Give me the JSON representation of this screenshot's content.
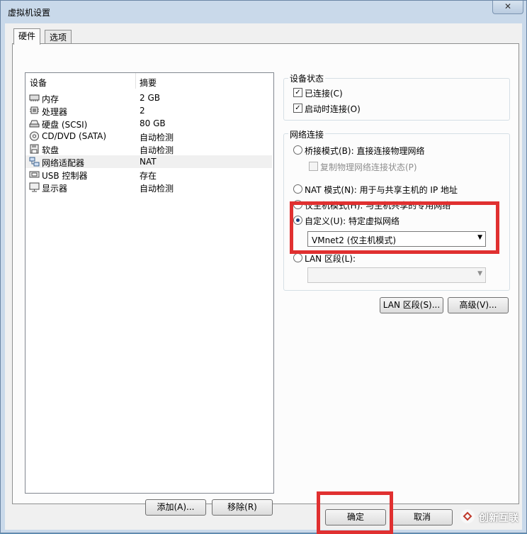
{
  "window": {
    "title": "虚拟机设置",
    "close_glyph": "✕"
  },
  "tabs": [
    {
      "label": "硬件",
      "active": true
    },
    {
      "label": "选项",
      "active": false
    }
  ],
  "device_list": {
    "columns": {
      "device": "设备",
      "summary": "摘要"
    },
    "rows": [
      {
        "icon": "memory-icon",
        "device": "内存",
        "summary": "2 GB"
      },
      {
        "icon": "cpu-icon",
        "device": "处理器",
        "summary": "2"
      },
      {
        "icon": "hard-disk-icon",
        "device": "硬盘 (SCSI)",
        "summary": "80 GB"
      },
      {
        "icon": "cd-dvd-icon",
        "device": "CD/DVD (SATA)",
        "summary": "自动检测"
      },
      {
        "icon": "floppy-icon",
        "device": "软盘",
        "summary": "自动检测"
      },
      {
        "icon": "network-adapter-icon",
        "device": "网络适配器",
        "summary": "NAT",
        "selected": true
      },
      {
        "icon": "usb-icon",
        "device": "USB 控制器",
        "summary": "存在"
      },
      {
        "icon": "display-icon",
        "device": "显示器",
        "summary": "自动检测"
      }
    ]
  },
  "list_buttons": {
    "add": "添加(A)...",
    "remove": "移除(R)"
  },
  "device_status": {
    "title": "设备状态",
    "connected": {
      "label": "已连接(C)",
      "checked": true
    },
    "connect_on_power": {
      "label": "启动时连接(O)",
      "checked": true
    }
  },
  "network": {
    "title": "网络连接",
    "bridged": {
      "label": "桥接模式(B): 直接连接物理网络",
      "selected": false
    },
    "replicate": {
      "label": "复制物理网络连接状态(P)",
      "checked": false
    },
    "nat": {
      "label": "NAT 模式(N): 用于与共享主机的 IP 地址",
      "selected": false
    },
    "host_only": {
      "label": "仅主机模式(H): 与主机共享的专用网络",
      "selected": false
    },
    "custom": {
      "label": "自定义(U): 特定虚拟网络",
      "selected": true
    },
    "custom_value": "VMnet2 (仅主机模式)",
    "lan": {
      "label": "LAN 区段(L):",
      "selected": false
    },
    "lan_value": ""
  },
  "network_buttons": {
    "lan_segments": "LAN 区段(S)...",
    "advanced": "高级(V)..."
  },
  "dialog_buttons": {
    "ok": "确定",
    "cancel": "取消"
  },
  "watermark": {
    "text": "创新互联"
  },
  "colors": {
    "highlight": "#e03030",
    "title_bg": "#c9d9ea",
    "radio_dot": "#1c3f7a"
  }
}
